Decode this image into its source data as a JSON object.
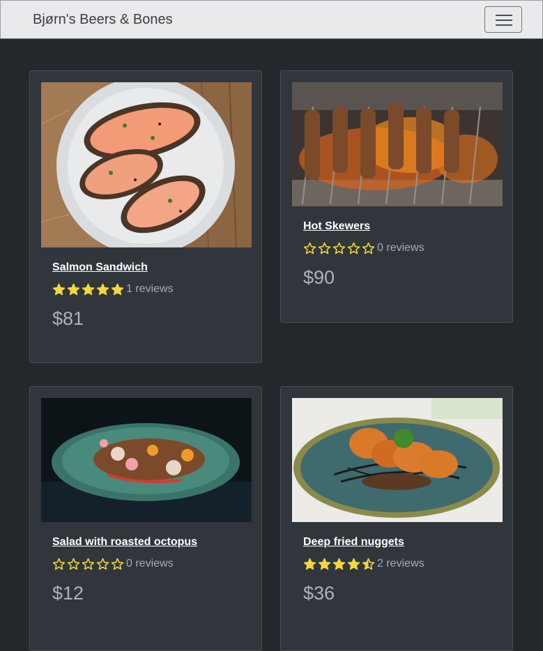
{
  "navbar": {
    "brand": "Bjørn's Beers & Bones",
    "toggle_icon": "hamburger-menu-icon"
  },
  "colors": {
    "star_fill": "#f2d73b",
    "background": "#24282d",
    "card": "#31363d"
  },
  "products": [
    {
      "title": "Salmon Sandwich",
      "rating": 5,
      "reviews_text": "1 reviews",
      "price": "$81",
      "image": "photo of salmon open sandwiches on a plate"
    },
    {
      "title": "Hot Skewers",
      "rating": 0,
      "reviews_text": "0 reviews",
      "price": "$90",
      "image": "photo of meat skewers over a flaming grill"
    },
    {
      "title": "Salad with roasted octopus",
      "rating": 0,
      "reviews_text": "0 reviews",
      "price": "$12",
      "image": "photo of octopus salad on a teal plate"
    },
    {
      "title": "Deep fried nuggets",
      "rating": 4.5,
      "reviews_text": "2 reviews",
      "price": "$36",
      "image": "photo of fried nuggets with sauce on a teal plate"
    }
  ]
}
